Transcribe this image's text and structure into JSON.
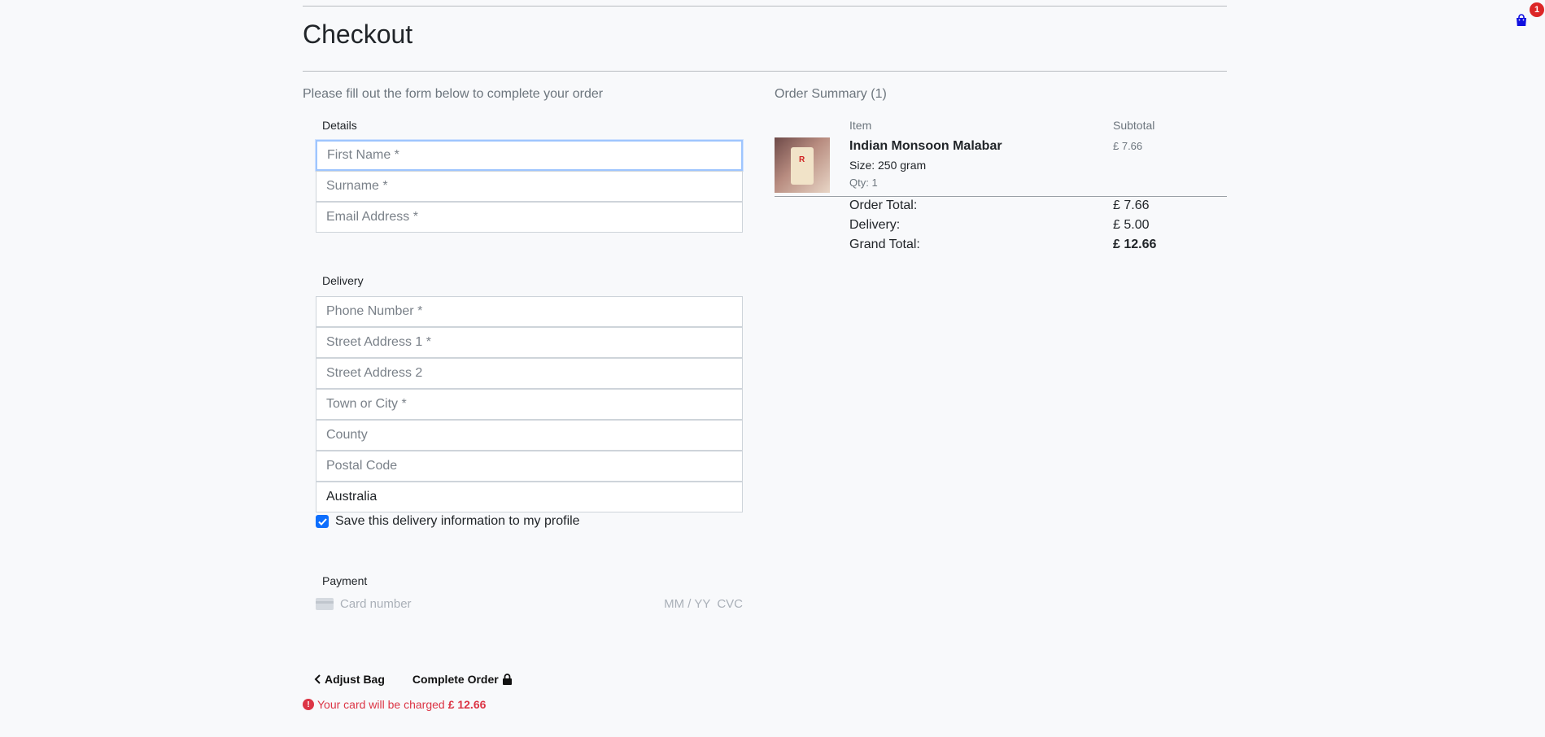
{
  "page": {
    "title": "Checkout",
    "intro": "Please fill out the form below to complete your order"
  },
  "details": {
    "label": "Details",
    "first_name_placeholder": "First Name *",
    "surname_placeholder": "Surname *",
    "email_placeholder": "Email Address *"
  },
  "delivery": {
    "label": "Delivery",
    "phone_placeholder": "Phone Number *",
    "street1_placeholder": "Street Address 1 *",
    "street2_placeholder": "Street Address 2",
    "town_placeholder": "Town or City *",
    "county_placeholder": "County",
    "postcode_placeholder": "Postal Code",
    "country_value": "Australia",
    "save_label": "Save this delivery information to my profile",
    "save_checked": true
  },
  "payment": {
    "label": "Payment",
    "card_placeholder": "Card number",
    "expiry_placeholder": "MM / YY",
    "cvc_placeholder": "CVC"
  },
  "actions": {
    "adjust_label": "Adjust Bag",
    "complete_label": "Complete Order",
    "charge_text": "Your card will be charged",
    "charge_amount": "£ 12.66"
  },
  "summary": {
    "title": "Order Summary (1)",
    "col_item": "Item",
    "col_subtotal": "Subtotal",
    "items": [
      {
        "name": "Indian Monsoon Malabar",
        "size": "Size: 250 gram",
        "qty": "Qty: 1",
        "subtotal": "£ 7.66",
        "image_logo": "R"
      }
    ],
    "order_total_label": "Order Total:",
    "order_total": "£ 7.66",
    "delivery_label": "Delivery:",
    "delivery_cost": "£ 5.00",
    "grand_total_label": "Grand Total:",
    "grand_total": "£ 12.66"
  },
  "cart": {
    "count": "1",
    "icon": "shopping-bag-icon",
    "color": "#1010e0"
  },
  "colors": {
    "accent": "#0d6efd",
    "error": "#dc3545"
  }
}
